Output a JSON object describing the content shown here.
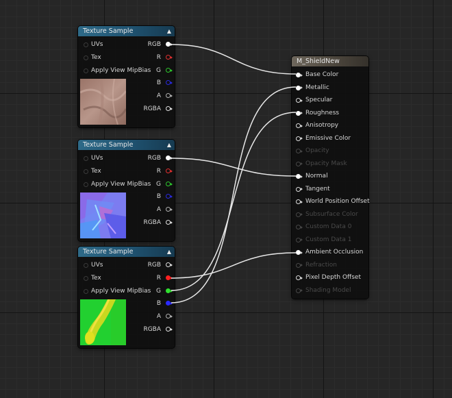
{
  "texture_nodes": [
    {
      "title": "Texture Sample",
      "inputs": [
        "UVs",
        "Tex",
        "Apply View MipBias"
      ],
      "outputs": [
        {
          "label": "RGB",
          "color": "#ffffff",
          "connected": true
        },
        {
          "label": "R",
          "color": "#e23030",
          "connected": false
        },
        {
          "label": "G",
          "color": "#2ec82e",
          "connected": false
        },
        {
          "label": "B",
          "color": "#2a2ae0",
          "connected": false
        },
        {
          "label": "A",
          "color": "#b0b0b0",
          "connected": false
        },
        {
          "label": "RGBA",
          "color": "#e0e0e0",
          "connected": false
        }
      ],
      "preview": "base-color-texture"
    },
    {
      "title": "Texture Sample",
      "inputs": [
        "UVs",
        "Tex",
        "Apply View MipBias"
      ],
      "outputs": [
        {
          "label": "RGB",
          "color": "#ffffff",
          "connected": true
        },
        {
          "label": "R",
          "color": "#e23030",
          "connected": false
        },
        {
          "label": "G",
          "color": "#2ec82e",
          "connected": false
        },
        {
          "label": "B",
          "color": "#2a2ae0",
          "connected": false
        },
        {
          "label": "A",
          "color": "#b0b0b0",
          "connected": false
        },
        {
          "label": "RGBA",
          "color": "#e0e0e0",
          "connected": false
        }
      ],
      "preview": "normal-map-texture"
    },
    {
      "title": "Texture Sample",
      "inputs": [
        "UVs",
        "Tex",
        "Apply View MipBias"
      ],
      "outputs": [
        {
          "label": "RGB",
          "color": "#e0e0e0",
          "connected": false
        },
        {
          "label": "R",
          "color": "#ff2020",
          "connected": true
        },
        {
          "label": "G",
          "color": "#30e030",
          "connected": true
        },
        {
          "label": "B",
          "color": "#2a2aff",
          "connected": true
        },
        {
          "label": "A",
          "color": "#b0b0b0",
          "connected": false
        },
        {
          "label": "RGBA",
          "color": "#e0e0e0",
          "connected": false
        }
      ],
      "preview": "packed-mask-texture"
    }
  ],
  "material_node": {
    "title": "M_ShieldNew",
    "inputs": [
      {
        "label": "Base Color",
        "enabled": true,
        "connected": true
      },
      {
        "label": "Metallic",
        "enabled": true,
        "connected": true
      },
      {
        "label": "Specular",
        "enabled": true,
        "connected": false
      },
      {
        "label": "Roughness",
        "enabled": true,
        "connected": true
      },
      {
        "label": "Anisotropy",
        "enabled": true,
        "connected": false
      },
      {
        "label": "Emissive Color",
        "enabled": true,
        "connected": false
      },
      {
        "label": "Opacity",
        "enabled": false,
        "connected": false
      },
      {
        "label": "Opacity Mask",
        "enabled": false,
        "connected": false
      },
      {
        "label": "Normal",
        "enabled": true,
        "connected": true
      },
      {
        "label": "Tangent",
        "enabled": true,
        "connected": false
      },
      {
        "label": "World Position Offset",
        "enabled": true,
        "connected": false
      },
      {
        "label": "Subsurface Color",
        "enabled": false,
        "connected": false
      },
      {
        "label": "Custom Data 0",
        "enabled": false,
        "connected": false
      },
      {
        "label": "Custom Data 1",
        "enabled": false,
        "connected": false
      },
      {
        "label": "Ambient Occlusion",
        "enabled": true,
        "connected": true
      },
      {
        "label": "Refraction",
        "enabled": false,
        "connected": false
      },
      {
        "label": "Pixel Depth Offset",
        "enabled": true,
        "connected": false
      },
      {
        "label": "Shading Model",
        "enabled": false,
        "connected": false
      }
    ]
  },
  "connections": [
    {
      "from": "node1.RGB",
      "to": "Base Color"
    },
    {
      "from": "node2.RGB",
      "to": "Normal"
    },
    {
      "from": "node3.R",
      "to": "Ambient Occlusion"
    },
    {
      "from": "node3.G",
      "to": "Roughness"
    },
    {
      "from": "node3.B",
      "to": "Metallic"
    }
  ],
  "icons": {
    "collapse": "collapse-arrow-icon",
    "input_pin": "input-pin-icon",
    "output_pin": "output-pin-icon"
  },
  "colors": {
    "canvas_bg": "#262626",
    "texture_header": "#2e6a88",
    "material_header": "#6e675c",
    "wire": "#e8e8e8"
  }
}
